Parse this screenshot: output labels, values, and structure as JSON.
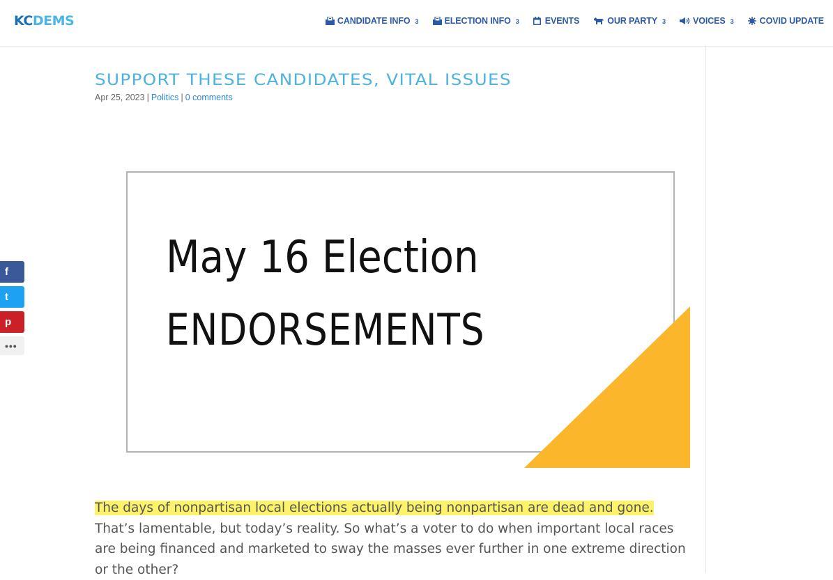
{
  "header": {
    "logo": {
      "kc": "KC",
      "dems": "DEMS"
    },
    "nav": [
      {
        "label": "CANDIDATE INFO",
        "icon": "ballot-icon",
        "has_dropdown": true
      },
      {
        "label": "ELECTION INFO",
        "icon": "ballot-icon",
        "has_dropdown": true
      },
      {
        "label": "EVENTS",
        "icon": "calendar-icon",
        "has_dropdown": false
      },
      {
        "label": "OUR PARTY",
        "icon": "donkey-icon",
        "has_dropdown": true
      },
      {
        "label": "VOICES",
        "icon": "megaphone-icon",
        "has_dropdown": true
      },
      {
        "label": "COVID UPDATE",
        "icon": "virus-icon",
        "has_dropdown": false
      }
    ],
    "dropdown_glyph": "3"
  },
  "post": {
    "title": "Support these candidates, vital issues",
    "date": "Apr 25, 2023",
    "separator": "|",
    "category": "Politics",
    "comments": "0 comments",
    "image": {
      "line1": "May 16 Election",
      "line2": "ENDORSEMENTS",
      "accent_color": "#fbb62b"
    },
    "highlight": "The days of nonpartisan local elections actually being nonpartisan are dead and gone.",
    "body": " That’s lamentable, but today’s reality. So what’s a voter to do when important local races are being financed and marketed to sway the masses ever further in one extreme direction or the other?"
  },
  "share": {
    "facebook": "f",
    "twitter": "t",
    "pinterest": "p",
    "more": "•••"
  },
  "colors": {
    "accent": "#4cb2e0",
    "nav": "#2b5aa8",
    "link": "#2b87da",
    "highlight": "#fdf36b"
  }
}
